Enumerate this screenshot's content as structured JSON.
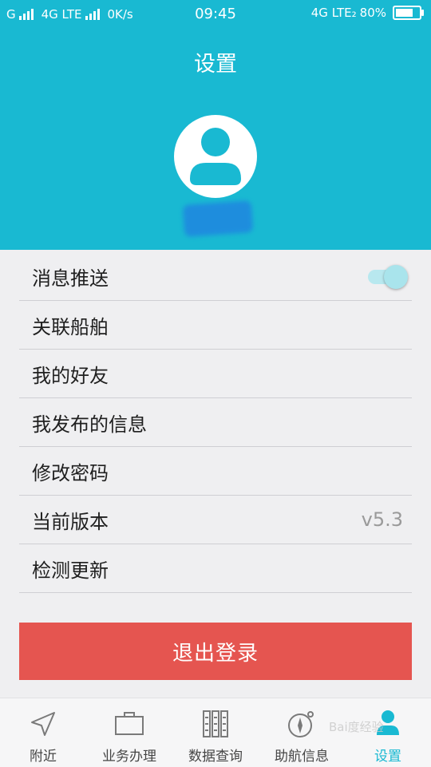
{
  "status_bar": {
    "left_text_1": "G",
    "left_text_2": "4G LTE",
    "speed": "0K/s",
    "time": "09:45",
    "right_network": "4G LTE₂",
    "battery_percent": "80%",
    "battery_level": 0.8
  },
  "header": {
    "title": "设置"
  },
  "settings": {
    "items": [
      {
        "label": "消息推送",
        "toggle_on": true
      },
      {
        "label": "关联船舶"
      },
      {
        "label": "我的好友"
      },
      {
        "label": "我发布的信息"
      },
      {
        "label": "修改密码"
      },
      {
        "label": "当前版本",
        "value": "v5.3"
      },
      {
        "label": "检测更新"
      }
    ]
  },
  "logout_label": "退出登录",
  "tabs": [
    {
      "label": "附近",
      "icon": "navigation-arrow-icon",
      "active": false
    },
    {
      "label": "业务办理",
      "icon": "briefcase-icon",
      "active": false
    },
    {
      "label": "数据查询",
      "icon": "data-columns-icon",
      "active": false
    },
    {
      "label": "助航信息",
      "icon": "compass-icon",
      "active": false
    },
    {
      "label": "设置",
      "icon": "user-icon",
      "active": true
    }
  ],
  "watermark": "Bai度经验",
  "colors": {
    "accent": "#19b9d2",
    "logout": "#e55550",
    "background": "#efeff1"
  }
}
